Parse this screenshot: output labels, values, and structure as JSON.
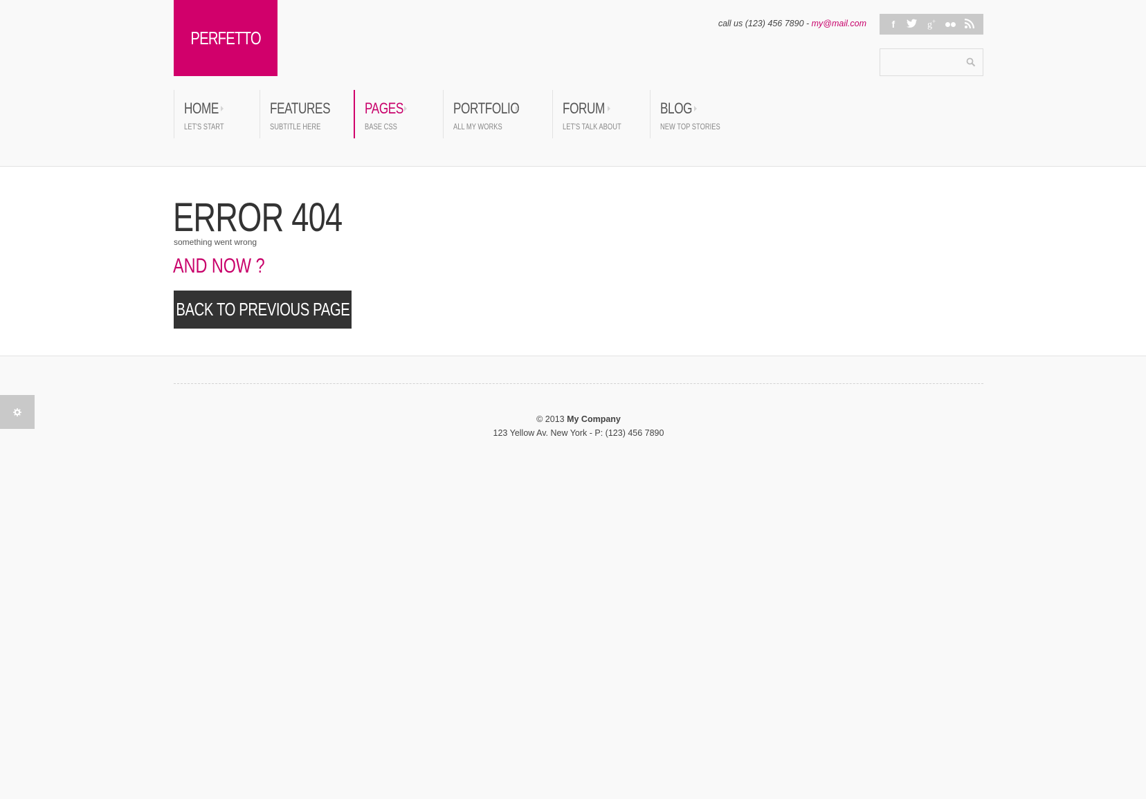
{
  "brand": {
    "logo_text": "PERFETTO",
    "accent_color": "#d1006b"
  },
  "contact": {
    "prefix": "call us (123) 456 7890 - ",
    "email": "my@mail.com"
  },
  "social": [
    {
      "name": "facebook-icon",
      "glyph": "f"
    },
    {
      "name": "twitter-icon",
      "glyph": "t"
    },
    {
      "name": "google-plus-icon",
      "glyph": "g+"
    },
    {
      "name": "flickr-icon",
      "glyph": ""
    },
    {
      "name": "rss-icon",
      "glyph": ""
    }
  ],
  "search": {
    "placeholder": ""
  },
  "nav": {
    "items": [
      {
        "label": "HOME",
        "sub": "LET'S START"
      },
      {
        "label": "FEATURES",
        "sub": "SUBTITLE HERE"
      },
      {
        "label": "PAGES",
        "sub": "BASE CSS"
      },
      {
        "label": "PORTFOLIO",
        "sub": "ALL MY WORKS"
      },
      {
        "label": "FORUM",
        "sub": "LET'S TALK ABOUT"
      },
      {
        "label": "BLOG",
        "sub": "NEW TOP STORIES"
      }
    ],
    "active": "PAGES"
  },
  "error": {
    "title": "ERROR 404",
    "subtitle": "something went wrong",
    "and_now": "AND NOW ?",
    "back_button": "BACK TO PREVIOUS PAGE"
  },
  "footer": {
    "copyright": "© 2013 ",
    "company": "My Company",
    "address": "123 Yellow Av. New York - P: (123) 456 7890"
  }
}
